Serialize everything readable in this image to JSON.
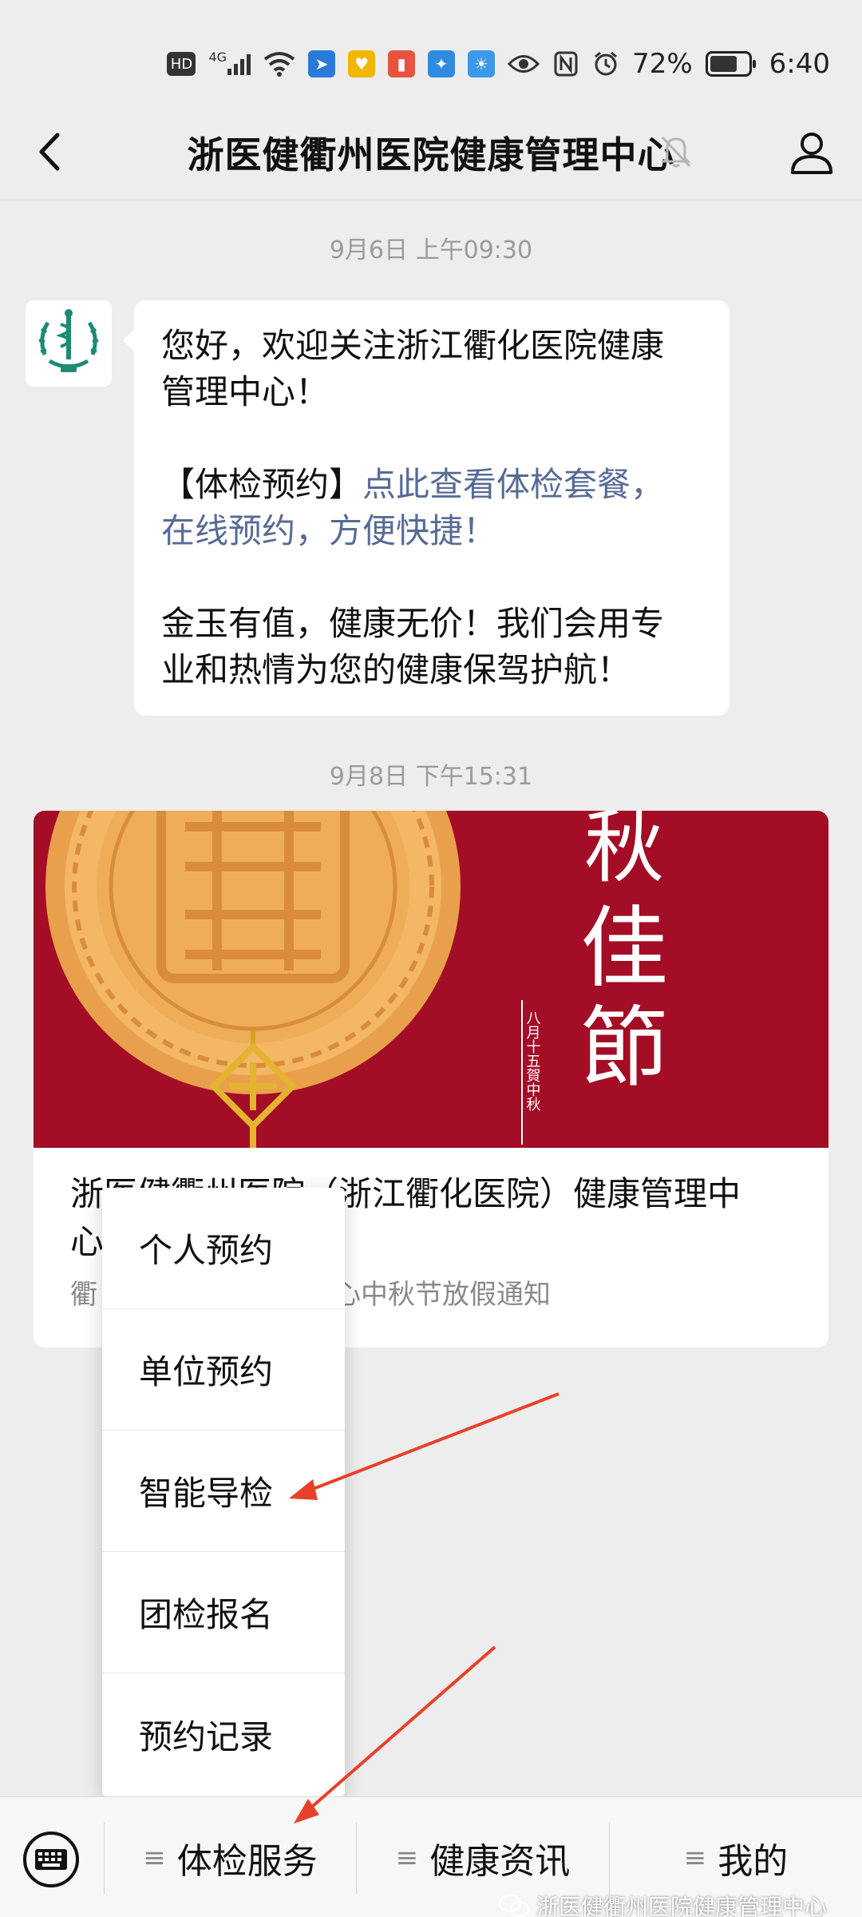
{
  "status_bar": {
    "hd_label": "HD",
    "network_label": "4G",
    "battery_percent": "72%",
    "battery_level": 0.72,
    "time": "6:40"
  },
  "header": {
    "title": "浙医健衢州医院健康管理中心",
    "back_icon": "chevron-left-icon",
    "mute_icon": "bell-off-icon",
    "profile_icon": "person-icon"
  },
  "messages": {
    "timestamp_1": "9月6日 上午09:30",
    "welcome_line_1": "您好，欢迎关注浙江衢化医院健康",
    "welcome_line_2": "管理中心！",
    "bracket_label": "【体检预约】",
    "link_text_1": "点此查看体检套餐，",
    "link_text_2": "在线预约，方便快捷！",
    "slogan_line_1": "金玉有值，健康无价！我们会用专",
    "slogan_line_2": "业和热情为您的健康保驾护航！",
    "timestamp_2": "9月8日 下午15:31"
  },
  "article": {
    "banner_text_1": "秋",
    "banner_text_2": "佳",
    "banner_text_3": "節",
    "banner_small_text": "八月十五賀中秋",
    "title_line_1": "浙医健衢州医院（浙江衢化医院）健康管理中",
    "title_line_2": "心",
    "desc_prefix": "衢",
    "desc_suffix": "心中秋节放假通知"
  },
  "popup_menu": {
    "items": [
      {
        "label": "个人预约"
      },
      {
        "label": "单位预约"
      },
      {
        "label": "智能导检"
      },
      {
        "label": "团检报名"
      },
      {
        "label": "预约记录"
      }
    ]
  },
  "bottom_bar": {
    "keyboard_icon": "keyboard-icon",
    "tab_1": "体检服务",
    "tab_2": "健康资讯",
    "tab_3": "我的"
  },
  "watermark": "浙医健衢州医院健康管理中心",
  "colors": {
    "link": "#576b95",
    "banner_red": "#a30d25",
    "mooncake": "#e9a04d",
    "arrow": "#e8402a"
  }
}
